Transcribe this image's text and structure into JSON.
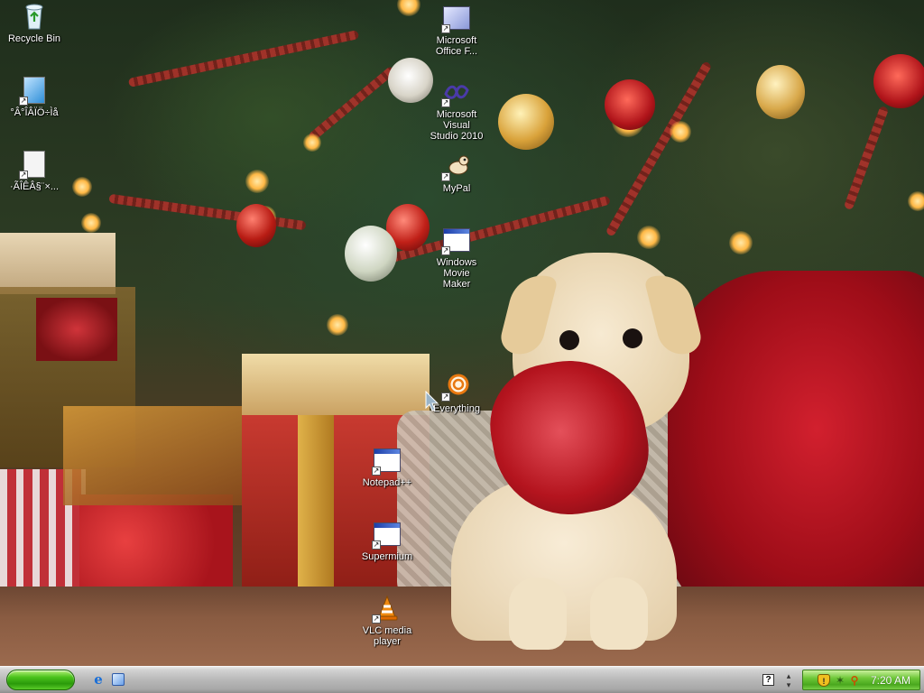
{
  "desktop": {
    "icons": [
      {
        "id": "recycle-bin",
        "label": "Recycle Bin",
        "shortcut": false
      },
      {
        "id": "shortcut-a",
        "label": "°Â°ÎÂÏÖ÷Ìå",
        "shortcut": true
      },
      {
        "id": "shortcut-b",
        "label": "·ÃÎÊÂ§¨×...",
        "shortcut": true
      },
      {
        "id": "ms-office",
        "label": "Microsoft\nOffice F...",
        "shortcut": true
      },
      {
        "id": "vs2010",
        "label": "Microsoft Visual\nStudio 2010",
        "shortcut": true
      },
      {
        "id": "mypal",
        "label": "MyPal",
        "shortcut": true
      },
      {
        "id": "movie-maker",
        "label": "Windows Movie\nMaker",
        "shortcut": true
      },
      {
        "id": "everything",
        "label": "Everything",
        "shortcut": true
      },
      {
        "id": "notepadpp",
        "label": "Notepad++",
        "shortcut": true
      },
      {
        "id": "supermium",
        "label": "Supermium",
        "shortcut": true
      },
      {
        "id": "vlc",
        "label": "VLC media\nplayer",
        "shortcut": true
      }
    ]
  },
  "taskbar": {
    "start_icon": "start-button",
    "quick_launch": [
      "internet-explorer-icon",
      "show-desktop-icon"
    ],
    "help_glyph": "?",
    "tray": {
      "icons": [
        "security-shield-icon",
        "network-icon",
        "search-icon"
      ],
      "clock": "7:20 AM"
    }
  },
  "colors": {
    "tray_green": "#4aa81e",
    "start_green": "#2a9a0a",
    "taskbar_gray": "#b8b8b8",
    "label_text": "#ffffff"
  }
}
